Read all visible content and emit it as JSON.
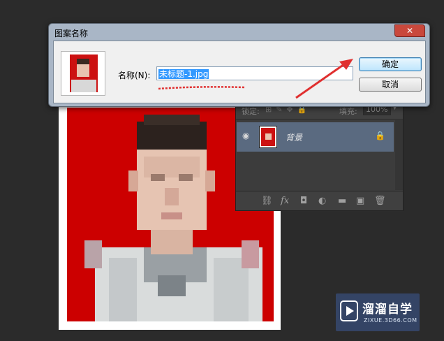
{
  "dialog": {
    "title": "图案名称",
    "close_icon": "close-icon",
    "name_label": "名称(N):",
    "name_value": "未标题-1.jpg",
    "ok_label": "确定",
    "cancel_label": "取消"
  },
  "layers_panel": {
    "lock_label": "锁定:",
    "fill_label": "填充:",
    "fill_value": "100%",
    "layer_name": "背景",
    "icons": [
      "eye-icon",
      "lock-icon",
      "link-icon",
      "fx-icon",
      "mask-icon",
      "adjustment-icon",
      "folder-icon",
      "new-layer-icon",
      "trash-icon"
    ]
  },
  "watermark": {
    "brand": "溜溜自学",
    "url": "ZIXUE.3D66.COM"
  },
  "colors": {
    "background": "#2b2b2b",
    "photo_red": "#cc0000",
    "selection": "#3399ff",
    "annotation_red": "#e03030",
    "layer_selected": "#5a6a80"
  }
}
